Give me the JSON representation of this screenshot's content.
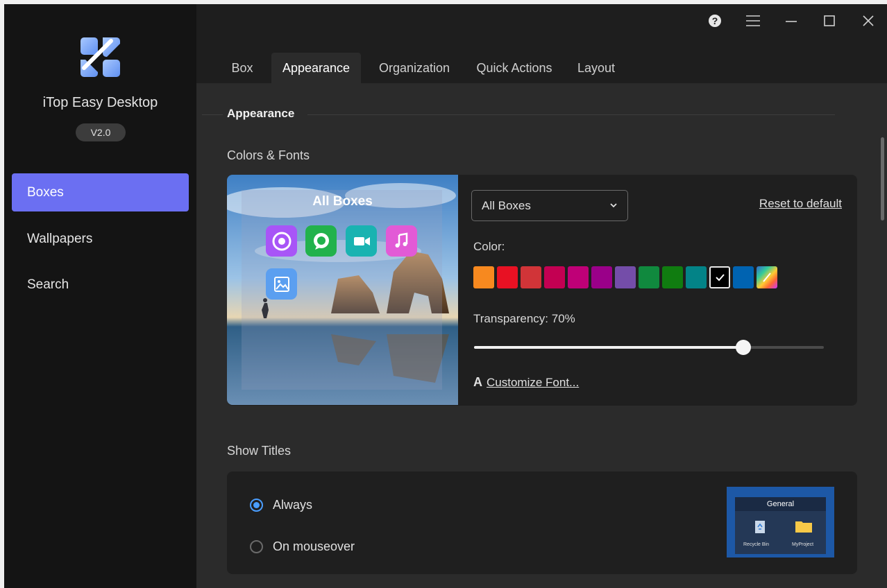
{
  "app": {
    "name": "iTop Easy Desktop",
    "version": "V2.0"
  },
  "sidebar": {
    "items": [
      {
        "label": "Boxes",
        "active": true
      },
      {
        "label": "Wallpapers",
        "active": false
      },
      {
        "label": "Search",
        "active": false
      }
    ]
  },
  "titlebar": {
    "icons": [
      "help-icon",
      "menu-icon",
      "minimize-icon",
      "maximize-icon",
      "close-icon"
    ]
  },
  "tabs": [
    {
      "label": "Box",
      "active": false
    },
    {
      "label": "Appearance",
      "active": true
    },
    {
      "label": "Organization",
      "active": false
    },
    {
      "label": "Quick Actions",
      "active": false
    },
    {
      "label": "Layout",
      "active": false
    }
  ],
  "appearance": {
    "section_title": "Appearance",
    "colors_fonts_title": "Colors & Fonts",
    "preview": {
      "box_title": "All Boxes",
      "icons": [
        "chrome-icon",
        "whatsapp-icon",
        "video-icon",
        "music-icon",
        "photos-icon"
      ]
    },
    "target_select": {
      "value": "All Boxes"
    },
    "reset_label": "Reset to default",
    "color_label": "Color:",
    "colors": [
      "#f7891f",
      "#e81123",
      "#d13438",
      "#c30052",
      "#bf0077",
      "#9a0089",
      "#744da9",
      "#10893e",
      "#107c10",
      "#038387",
      "#000000",
      "#0063b1",
      "rainbow"
    ],
    "selected_color_index": 10,
    "transparency_label": "Transparency: 70%",
    "transparency_value": 0.77,
    "font_icon": "A",
    "customize_font_label": "Customize Font..."
  },
  "show_titles": {
    "title": "Show Titles",
    "options": [
      {
        "label": "Always",
        "selected": true
      },
      {
        "label": "On mouseover",
        "selected": false
      }
    ],
    "preview": {
      "header": "General",
      "items": [
        "Recycle Bin",
        "MyProject"
      ]
    }
  },
  "accent_color": "#6b6ff2"
}
